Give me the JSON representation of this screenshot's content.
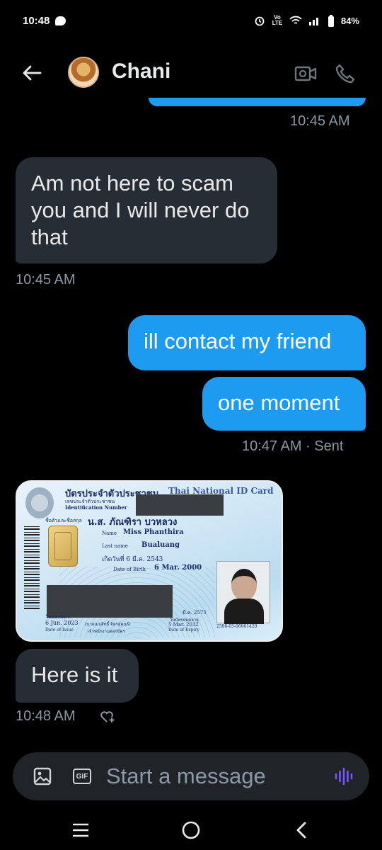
{
  "status_bar": {
    "time": "10:48",
    "network": "Vo LTE",
    "battery": "84%"
  },
  "header": {
    "contact_name": "Chani"
  },
  "messages": [
    {
      "time": "10:45 AM"
    },
    {
      "direction": "received",
      "text": "Am not here to scam you and I will never do that",
      "time": "10:45 AM"
    },
    {
      "direction": "sent",
      "text": "ill contact my friend"
    },
    {
      "direction": "sent",
      "text": "one moment",
      "time": "10:47 AM · Sent"
    },
    {
      "direction": "received",
      "type": "image"
    },
    {
      "direction": "received",
      "text": "Here is it",
      "time": "10:48 AM"
    }
  ],
  "id_card": {
    "title_th": "บัตรประจำตัวประชาชน",
    "title_en": "Thai National ID Card",
    "id_label_th": "เลขประจำตัวประชาชน",
    "id_label_en": "Identification Number",
    "name_label_th": "ชื่อตัวและชื่อสกุล",
    "name_th": "น.ส. ภัณฑิรา บวหลวง",
    "name_label": "Name",
    "name_en": "Miss Phanthira",
    "lastname_label": "Last name",
    "lastname_en": "Bualuang",
    "dob_th": "เกิดวันที่ 6 มี.ค. 2543",
    "dob_label": "Date of Birth",
    "dob_en": "6 Mar. 2000",
    "issue_th": "วันออกบัตร",
    "issue_date": "6 Jun. 2023",
    "issue_label": "Date of Issue",
    "officer": "(นายเมธสิทธิ์ จิตรสุคนธ์)",
    "officer_title": "เจ้าพนักงานออกบัตร",
    "expiry_th": "มี.ค. 2575",
    "expiry_label_th": "วันบัตรหมดอายุ",
    "expiry_date": "5 Mar. 2032",
    "expiry_label": "Date of Expiry",
    "card_code": "2506-05-06061420"
  },
  "composer": {
    "placeholder": "Start a message",
    "gif_label": "GIF"
  },
  "colors": {
    "background": "#000000",
    "sent_bubble": "#1d9bf0",
    "received_bubble": "#262d34",
    "timestamp": "#8b98a5",
    "voice_accent": "#7856ff"
  },
  "icons": [
    "back-arrow-icon",
    "video-call-icon",
    "phone-icon",
    "image-icon",
    "gif-icon",
    "voice-icon",
    "reaction-add-icon",
    "menu-icon",
    "home-icon",
    "back-icon"
  ]
}
